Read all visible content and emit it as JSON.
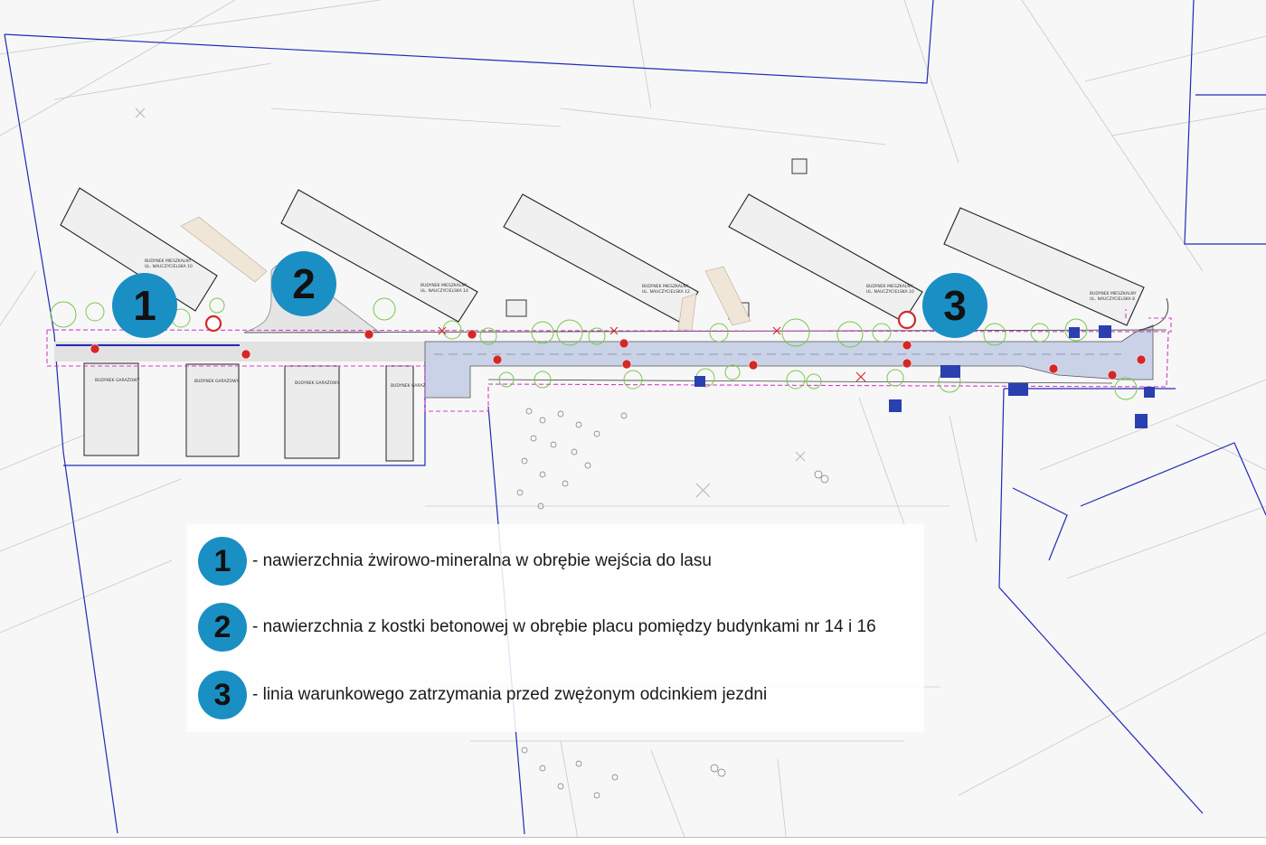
{
  "colors": {
    "marker": "#1a8fc4",
    "road_surface": "#c9d2e6",
    "boundary_line": "#1f2bb8",
    "project_boundary": "#d13fc7",
    "tree_outline": "#79c94a"
  },
  "markers": [
    {
      "id": "1",
      "label": "1"
    },
    {
      "id": "2",
      "label": "2"
    },
    {
      "id": "3",
      "label": "3"
    }
  ],
  "legend": {
    "items": [
      {
        "number": "1",
        "text": "- nawierzchnia żwirowo-mineralna w obrębie wejścia do lasu"
      },
      {
        "number": "2",
        "text": "- nawierzchnia z kostki betonowej w obrębie placu pomiędzy budynkami nr 14 i 16"
      },
      {
        "number": "3",
        "text": "- linia warunkowego zatrzymania przed zwężonym odcinkiem jezdni"
      }
    ]
  },
  "buildings": {
    "residential": [
      {
        "name": "BUDYNEK MIESZKALNY",
        "address": "UL. NAUCZYCIELSKA 10"
      },
      {
        "name": "BUDYNEK MIESZKALNY",
        "address": "UL. NAUCZYCIELSKA 14"
      },
      {
        "name": "BUDYNEK MIESZKALNY",
        "address": "UL. NAUCZYCIELSKA 12"
      },
      {
        "name": "BUDYNEK MIESZKALNY",
        "address": "UL. NAUCZYCIELSKA 10"
      },
      {
        "name": "BUDYNEK MIESZKALNY",
        "address": "UL. NAUCZYCIELSKA 8"
      }
    ],
    "garages": [
      {
        "name": "BUDYNEK GARAŻOWY"
      },
      {
        "name": "BUDYNEK GARAŻOWY"
      },
      {
        "name": "BUDYNEK GARAŻOWY"
      },
      {
        "name": "BUDYNEK GARAŻOWY"
      }
    ]
  }
}
